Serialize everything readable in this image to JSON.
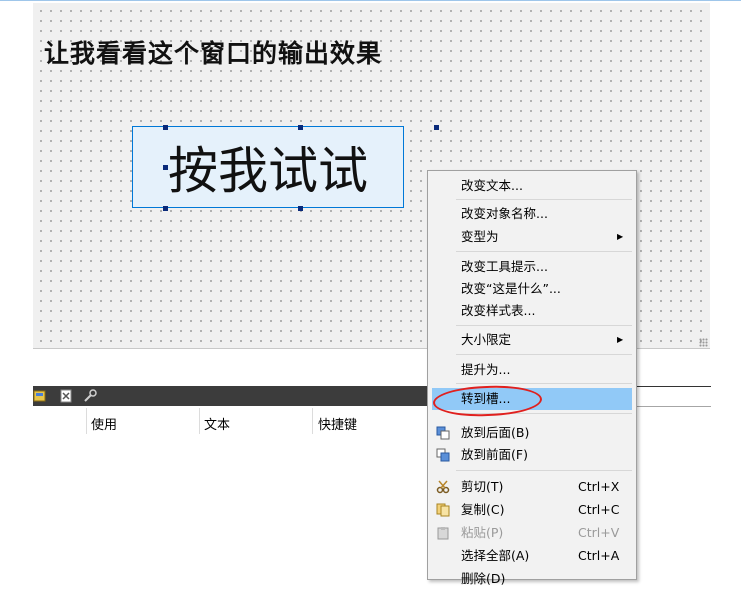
{
  "form": {
    "label_text": "让我看看这个窗口的输出效果",
    "button_text": "按我试试"
  },
  "signal_editor": {
    "columns": [
      "使用",
      "文本",
      "快捷键"
    ]
  },
  "context_menu": {
    "items": [
      {
        "label": "改变文本..."
      },
      {
        "label": "改变对象名称..."
      },
      {
        "label": "变型为",
        "arrow": "▶"
      },
      {
        "label": "改变工具提示..."
      },
      {
        "label": "改变“这是什么”..."
      },
      {
        "label": "改变样式表..."
      },
      {
        "label": "大小限定",
        "arrow": "▶"
      },
      {
        "label": "提升为..."
      },
      {
        "label": "转到槽..."
      },
      {
        "label": "放到后面(B)"
      },
      {
        "label": "放到前面(F)"
      },
      {
        "label": "剪切(T)",
        "shortcut": "Ctrl+X"
      },
      {
        "label": "复制(C)",
        "shortcut": "Ctrl+C"
      },
      {
        "label": "粘贴(P)",
        "shortcut": "Ctrl+V"
      },
      {
        "label": "选择全部(A)",
        "shortcut": "Ctrl+A"
      },
      {
        "label": "删除(D)"
      }
    ]
  },
  "colors": {
    "selection": "#91c9f7",
    "annotation": "#e0201e",
    "button_border": "#0078d7"
  }
}
